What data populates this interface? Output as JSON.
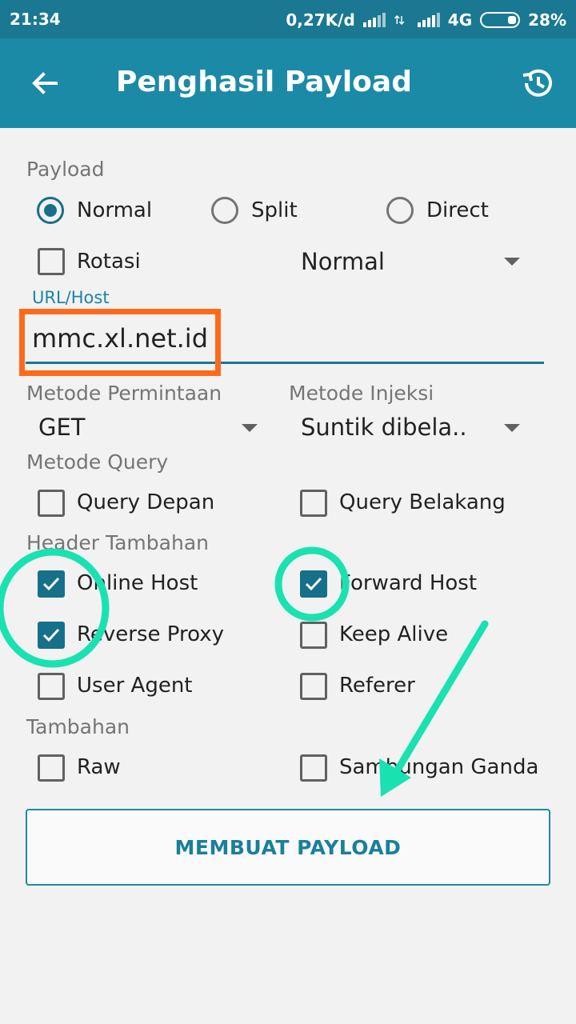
{
  "status_bar": {
    "time": "21:34",
    "speed": "0,27K/d",
    "network": "4G",
    "battery": "28%"
  },
  "app_bar": {
    "title": "Penghasil Payload",
    "back_icon": "arrow-back-icon",
    "history_icon": "history-icon"
  },
  "payload": {
    "label": "Payload",
    "options": [
      "Normal",
      "Split",
      "Direct"
    ],
    "selected": "Normal",
    "rotation_label": "Rotasi",
    "rotation_checked": false,
    "mode_value": "Normal"
  },
  "url": {
    "label": "URL/Host",
    "value": "mmc.xl.net.id"
  },
  "request_method": {
    "label": "Metode Permintaan",
    "value": "GET"
  },
  "injection_method": {
    "label": "Metode Injeksi",
    "value": "Suntik dibela.."
  },
  "query_method": {
    "label": "Metode Query",
    "options": [
      {
        "label": "Query Depan",
        "checked": false
      },
      {
        "label": "Query Belakang",
        "checked": false
      }
    ]
  },
  "extra_header": {
    "label": "Header Tambahan",
    "options": [
      {
        "label": "Online Host",
        "checked": true
      },
      {
        "label": "Forward Host",
        "checked": true
      },
      {
        "label": "Reverse Proxy",
        "checked": true
      },
      {
        "label": "Keep Alive",
        "checked": false
      },
      {
        "label": "User Agent",
        "checked": false
      },
      {
        "label": "Referer",
        "checked": false
      }
    ]
  },
  "extras": {
    "label": "Tambahan",
    "options": [
      {
        "label": "Raw",
        "checked": false
      },
      {
        "label": "Sambungan Ganda",
        "checked": false
      }
    ]
  },
  "submit_label": "MEMBUAT PAYLOAD",
  "colors": {
    "primary": "#1b8aa6",
    "status_bar": "#1a7892",
    "accent": "#16708a",
    "highlight_box": "#ff6a1a",
    "annotation": "#19e2b0"
  }
}
